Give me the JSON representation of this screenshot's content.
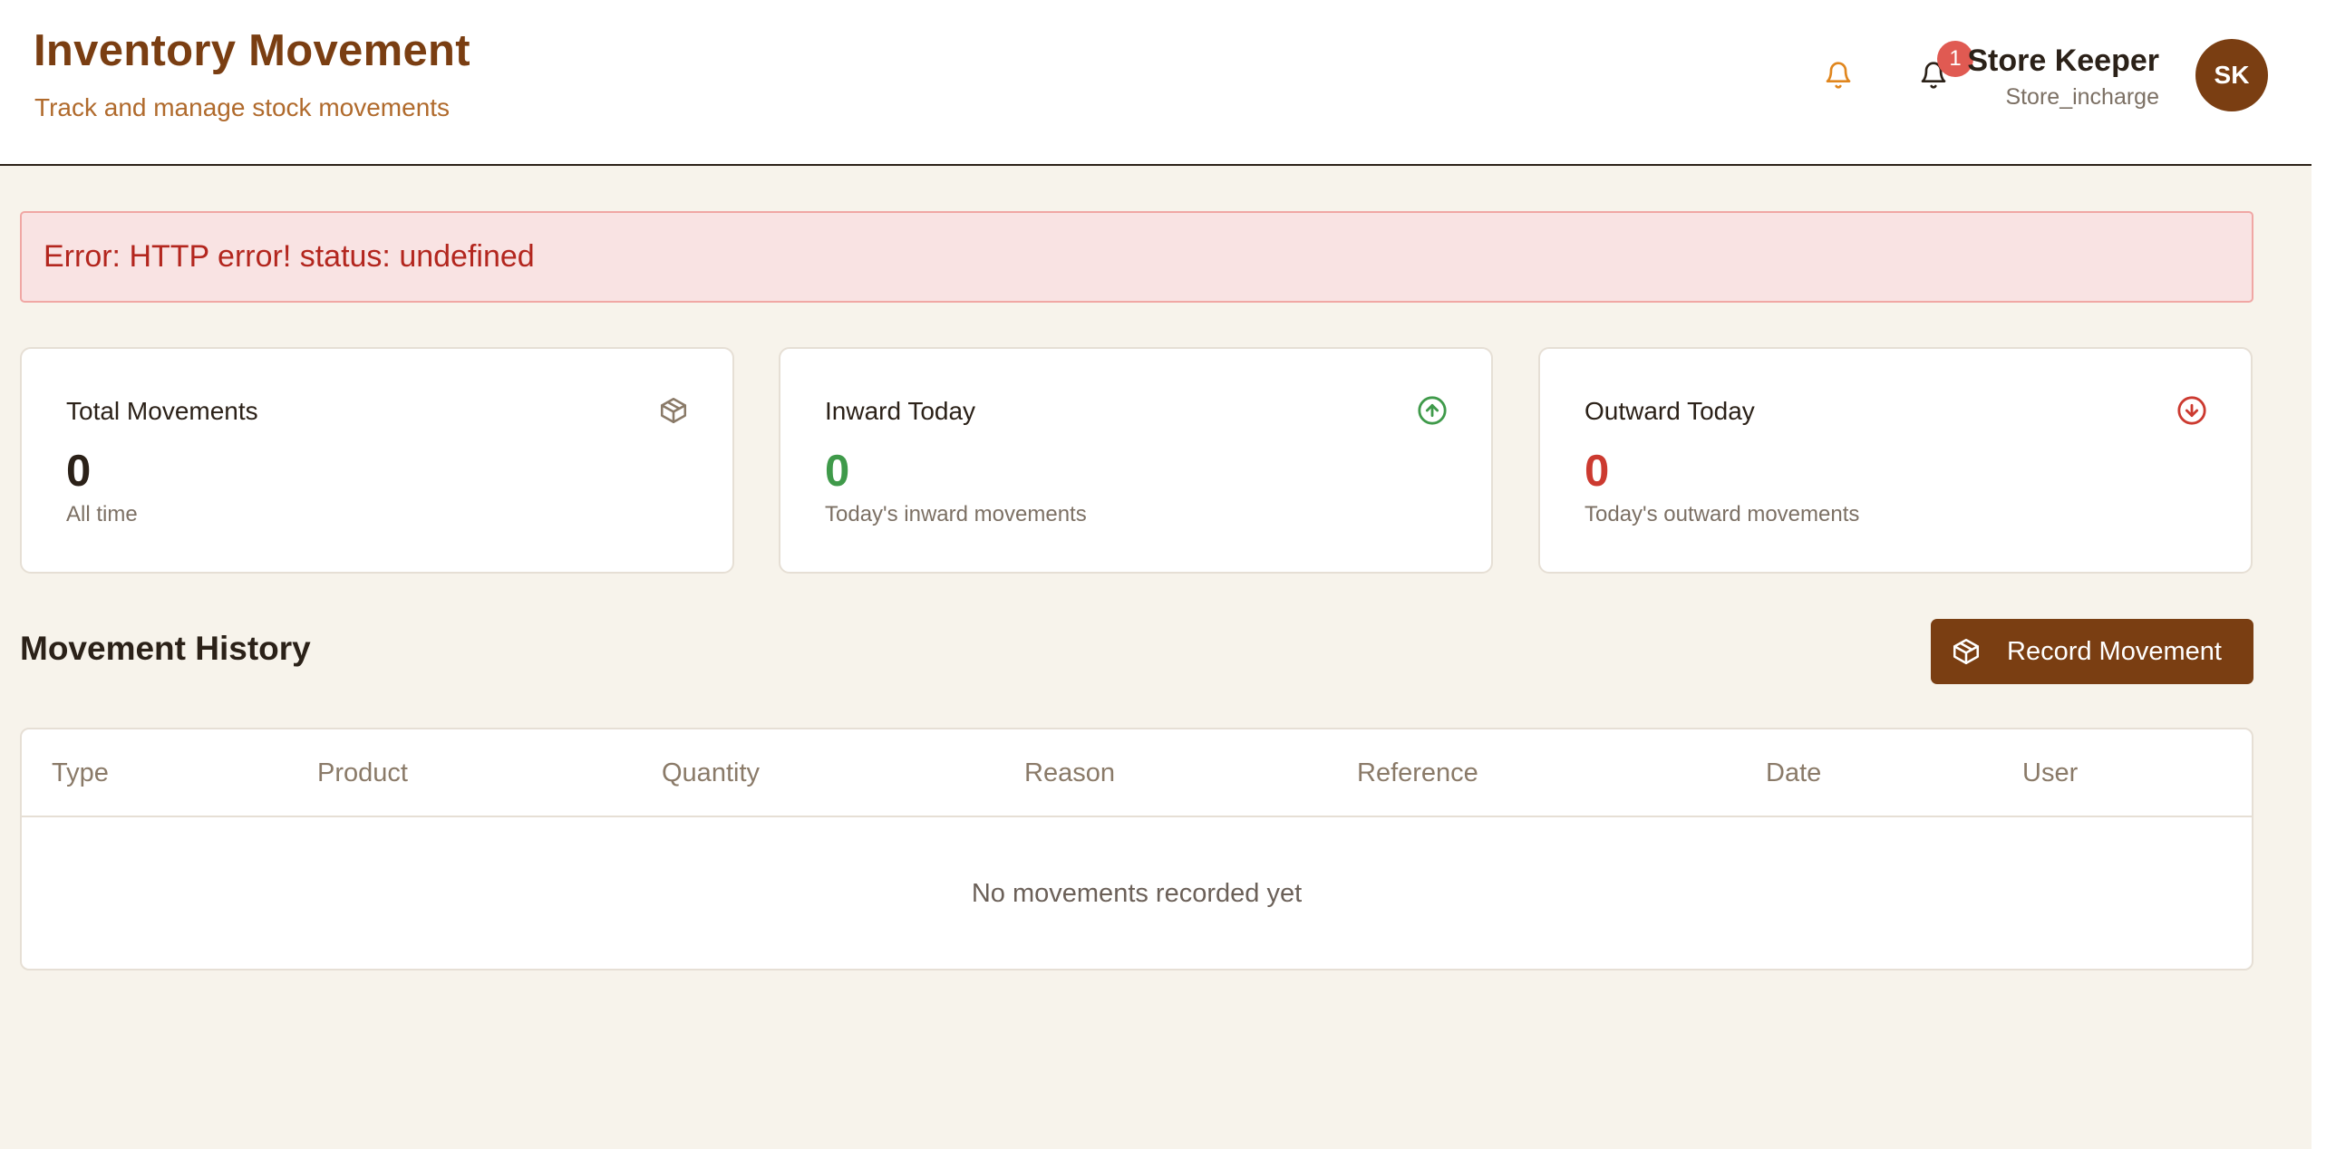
{
  "header": {
    "title": "Inventory Movement",
    "subtitle": "Track and manage stock movements",
    "notification_count": "1",
    "user_name": "Store Keeper",
    "user_role": "Store_incharge",
    "avatar_initials": "SK"
  },
  "error": {
    "message": "Error: HTTP error! status: undefined"
  },
  "stats": [
    {
      "title": "Total Movements",
      "value": "0",
      "caption": "All time",
      "icon": "package-icon"
    },
    {
      "title": "Inward Today",
      "value": "0",
      "caption": "Today's inward movements",
      "icon": "arrow-up-circle-icon"
    },
    {
      "title": "Outward Today",
      "value": "0",
      "caption": "Today's outward movements",
      "icon": "arrow-down-circle-icon"
    }
  ],
  "history": {
    "title": "Movement History",
    "record_button_label": "Record Movement",
    "columns": [
      "Type",
      "Product",
      "Quantity",
      "Reason",
      "Reference",
      "Date",
      "User"
    ],
    "empty_message": "No movements recorded yet"
  },
  "colors": {
    "brand": "#7a3e12",
    "accent_orange": "#e0861e",
    "inward_green": "#3f9a4a",
    "outward_red": "#cc3a30",
    "error_bg": "#f9e3e3",
    "background": "#f7f3eb"
  }
}
